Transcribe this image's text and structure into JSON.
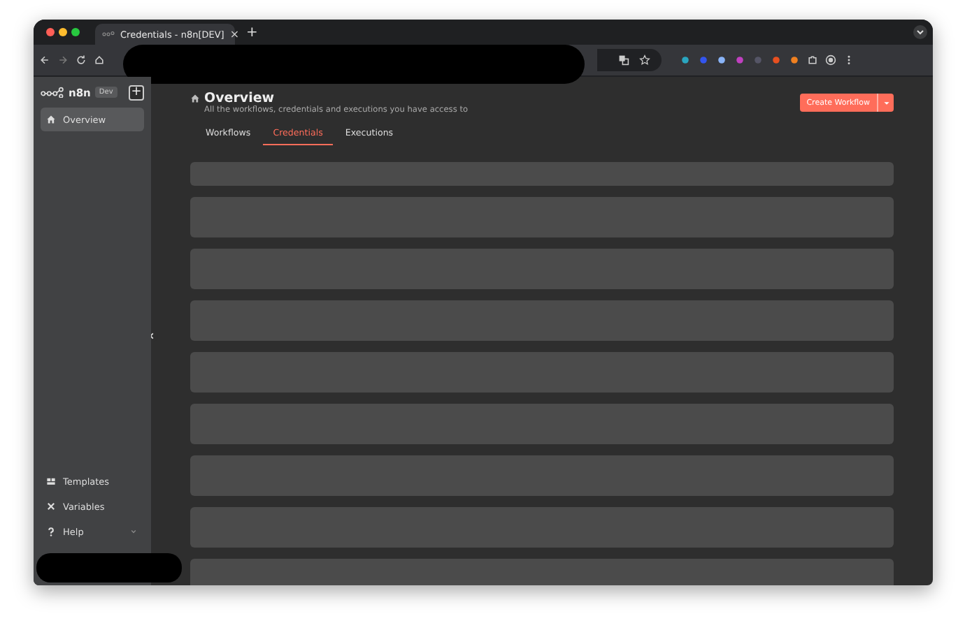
{
  "browser": {
    "tab_title": "Credentials - n8n[DEV]",
    "tab_close": "×",
    "new_tab": "+"
  },
  "sidebar": {
    "logo_text": "n8n",
    "badge": "Dev",
    "add_button": "+",
    "items": [
      {
        "label": "Overview",
        "kind": "home",
        "selected": true
      }
    ],
    "bottom_items": [
      {
        "label": "Templates",
        "kind": "templates",
        "selected": false
      },
      {
        "label": "Variables",
        "kind": "variables",
        "selected": false
      },
      {
        "label": "Help",
        "kind": "help",
        "selected": false,
        "expandable": true
      }
    ]
  },
  "header": {
    "title": "Overview",
    "subtitle": "All the workflows, credentials and executions you have access to",
    "create_button": "Create Workflow"
  },
  "tabs": [
    {
      "label": "Workflows",
      "selected": false
    },
    {
      "label": "Credentials",
      "selected": true
    },
    {
      "label": "Executions",
      "selected": false
    }
  ]
}
